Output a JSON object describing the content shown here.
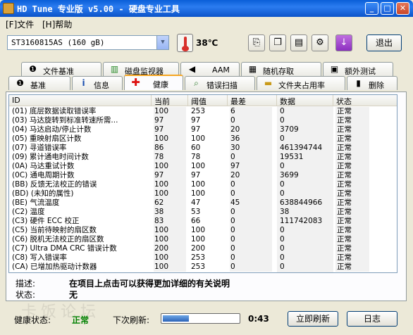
{
  "window": {
    "title": "HD Tune 专业版 v5.00 - 硬盘专业工具"
  },
  "menu": [
    "[F]文件",
    "[H]帮助"
  ],
  "toolbar": {
    "drive": "ST3160815AS (160 gB)",
    "temperature": "38℃",
    "exit_label": "退出",
    "icons": [
      "copy-text-icon",
      "copy-screenshot-icon",
      "save-icon",
      "options-icon",
      "download-icon"
    ]
  },
  "tabs_row1": [
    {
      "label": "文件基准",
      "icon": "file-benchmark-icon"
    },
    {
      "label": "磁盘监视器",
      "icon": "disk-monitor-icon"
    },
    {
      "label": "AAM",
      "icon": "speaker-icon"
    },
    {
      "label": "随机存取",
      "icon": "random-access-icon"
    },
    {
      "label": "额外测试",
      "icon": "extra-tests-icon"
    }
  ],
  "tabs_row2": [
    {
      "label": "基准",
      "icon": "benchmark-icon"
    },
    {
      "label": "信息",
      "icon": "info-icon"
    },
    {
      "label": "健康",
      "icon": "health-icon",
      "active": true
    },
    {
      "label": "错误扫描",
      "icon": "error-scan-icon"
    },
    {
      "label": "文件夹占用率",
      "icon": "folder-usage-icon"
    },
    {
      "label": "删除",
      "icon": "erase-icon"
    }
  ],
  "table": {
    "columns": [
      "ID",
      "当前",
      "阈值",
      "最差",
      "数据",
      "状态"
    ],
    "rows": [
      [
        "(01) 底层数据读取错误率",
        "100",
        "253",
        "6",
        "0",
        "正常"
      ],
      [
        "(03) 马达旋转到标准转速所需...",
        "97",
        "97",
        "0",
        "0",
        "正常"
      ],
      [
        "(04) 马达启动/停止计数",
        "97",
        "97",
        "20",
        "3709",
        "正常"
      ],
      [
        "(05) 重映射扇区计数",
        "100",
        "100",
        "36",
        "0",
        "正常"
      ],
      [
        "(07) 寻道错误率",
        "86",
        "60",
        "30",
        "461394744",
        "正常"
      ],
      [
        "(09) 累计通电时间计数",
        "78",
        "78",
        "0",
        "19531",
        "正常"
      ],
      [
        "(0A) 马达重试计数",
        "100",
        "100",
        "97",
        "0",
        "正常"
      ],
      [
        "(0C) 通电周期计数",
        "97",
        "97",
        "20",
        "3699",
        "正常"
      ],
      [
        "(BB) 反馈无法校正的错误",
        "100",
        "100",
        "0",
        "0",
        "正常"
      ],
      [
        "(BD) (未知的属性)",
        "100",
        "100",
        "0",
        "0",
        "正常"
      ],
      [
        "(BE) 气流温度",
        "62",
        "47",
        "45",
        "638844966",
        "正常"
      ],
      [
        "(C2) 温度",
        "38",
        "53",
        "0",
        "38",
        "正常"
      ],
      [
        "(C3) 硬件 ECC 校正",
        "83",
        "66",
        "0",
        "111742083",
        "正常"
      ],
      [
        "(C5) 当前待映射的扇区数",
        "100",
        "100",
        "0",
        "0",
        "正常"
      ],
      [
        "(C6) 脱机无法校正的扇区数",
        "100",
        "100",
        "0",
        "0",
        "正常"
      ],
      [
        "(C7) Ultra DMA CRC 错误计数",
        "200",
        "200",
        "0",
        "0",
        "正常"
      ],
      [
        "(C8) 写入错误率",
        "100",
        "253",
        "0",
        "0",
        "正常"
      ],
      [
        "(CA) 已增加热驱动计数器",
        "100",
        "253",
        "0",
        "0",
        "正常"
      ]
    ]
  },
  "details": {
    "desc_label": "描述:",
    "desc_value": "在项目上点击可以获得更加详细的有关说明",
    "status_label": "状态:",
    "status_value": "无"
  },
  "statusbar": {
    "health_label": "健康状态:",
    "health_value": "正常",
    "next_refresh_label": "下次刷新:",
    "progress_fraction": 0.35,
    "countdown": "0:43",
    "refresh_button": "立即刷新",
    "log_button": "日志"
  },
  "watermark": "卡饭论坛",
  "colors": {
    "accent": "#0b53c9",
    "ok": "#008000",
    "tab_highlight": "#f7a620"
  }
}
